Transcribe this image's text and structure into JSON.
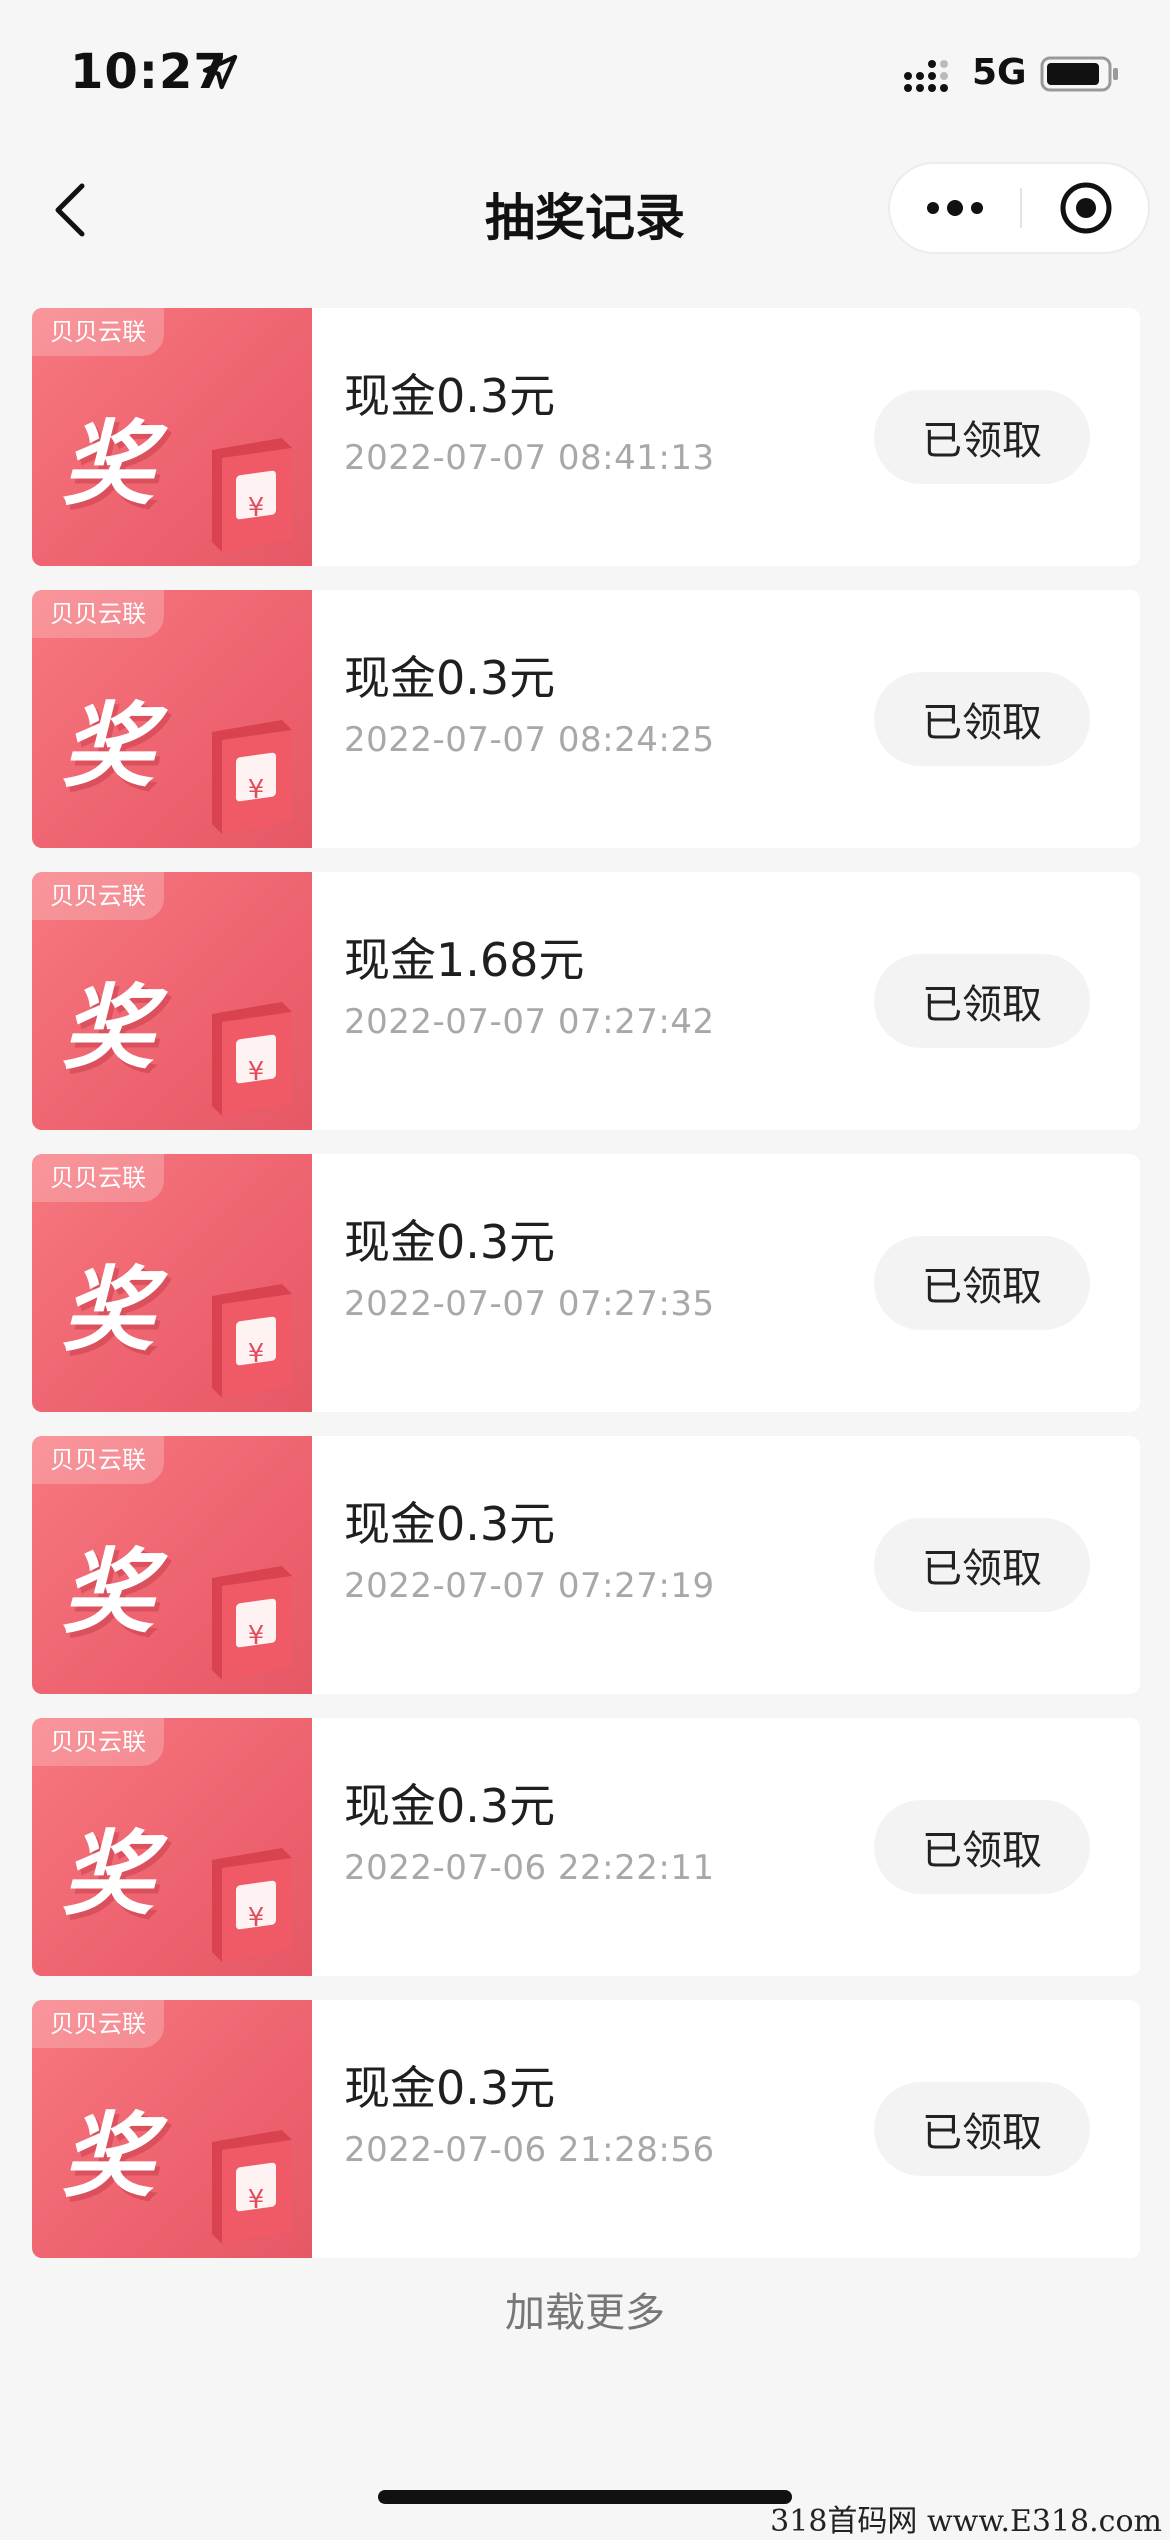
{
  "status_bar": {
    "time": "10:27",
    "network": "5G"
  },
  "nav": {
    "title": "抽奖记录"
  },
  "records": [
    {
      "brand": "贝贝云联",
      "prize_char": "奖",
      "title": "现金0.3元",
      "time": "2022-07-07 08:41:13",
      "status": "已领取"
    },
    {
      "brand": "贝贝云联",
      "prize_char": "奖",
      "title": "现金0.3元",
      "time": "2022-07-07 08:24:25",
      "status": "已领取"
    },
    {
      "brand": "贝贝云联",
      "prize_char": "奖",
      "title": "现金1.68元",
      "time": "2022-07-07 07:27:42",
      "status": "已领取"
    },
    {
      "brand": "贝贝云联",
      "prize_char": "奖",
      "title": "现金0.3元",
      "time": "2022-07-07 07:27:35",
      "status": "已领取"
    },
    {
      "brand": "贝贝云联",
      "prize_char": "奖",
      "title": "现金0.3元",
      "time": "2022-07-07 07:27:19",
      "status": "已领取"
    },
    {
      "brand": "贝贝云联",
      "prize_char": "奖",
      "title": "现金0.3元",
      "time": "2022-07-06 22:22:11",
      "status": "已领取"
    },
    {
      "brand": "贝贝云联",
      "prize_char": "奖",
      "title": "现金0.3元",
      "time": "2022-07-06 21:28:56",
      "status": "已领取"
    }
  ],
  "load_more": "加载更多",
  "watermark": "318首码网 www.E318.com",
  "colors": {
    "thumb_accent": "#ee6470",
    "background": "#f6f6f6"
  }
}
